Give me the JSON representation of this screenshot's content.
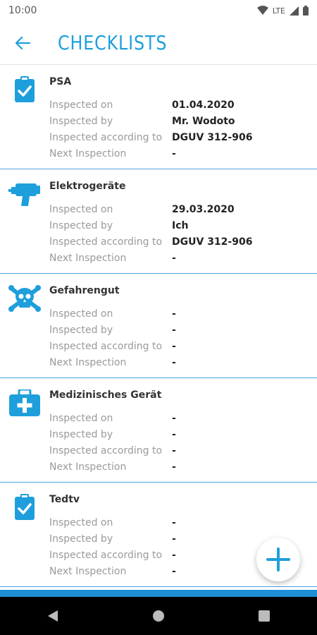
{
  "status": {
    "time": "10:00",
    "network": "LTE"
  },
  "header": {
    "title": "CHECKLISTS"
  },
  "labels": {
    "inspected_on": "Inspected on",
    "inspected_by": "Inspected by",
    "according_to": "Inspected according to",
    "next_inspection": "Next Inspection"
  },
  "cards": [
    {
      "title": "PSA",
      "icon": "clipboard-check-icon",
      "inspected_on": "01.04.2020",
      "inspected_by": "Mr. Wodoto",
      "according_to": "DGUV 312-906",
      "next_inspection": "-"
    },
    {
      "title": "Elektrogeräte",
      "icon": "drill-icon",
      "inspected_on": "29.03.2020",
      "inspected_by": "Ich",
      "according_to": "DGUV 312-906",
      "next_inspection": "-"
    },
    {
      "title": "Gefahrengut",
      "icon": "skull-crossbones-icon",
      "inspected_on": "-",
      "inspected_by": "-",
      "according_to": "-",
      "next_inspection": "-"
    },
    {
      "title": "Medizinisches Gerät",
      "icon": "medical-kit-icon",
      "inspected_on": "-",
      "inspected_by": "-",
      "according_to": "-",
      "next_inspection": "-"
    },
    {
      "title": "Tedtv",
      "icon": "clipboard-check-icon",
      "inspected_on": "-",
      "inspected_by": "-",
      "according_to": "-",
      "next_inspection": "-"
    }
  ],
  "colors": {
    "accent": "#1ea0dc",
    "divider": "#4aa3d9",
    "strip": "#1e8fd6"
  }
}
